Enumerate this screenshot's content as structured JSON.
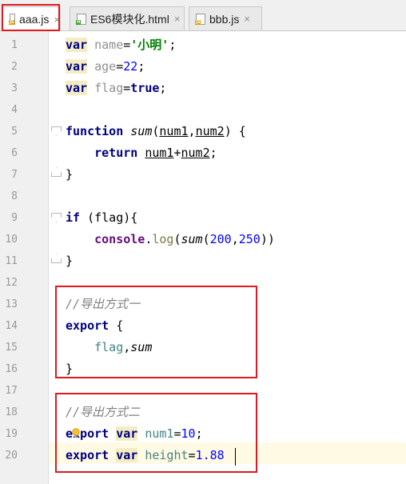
{
  "tabs": [
    {
      "label": "aaa.js",
      "type": "JS",
      "badge_color": "#d9a300",
      "active": true
    },
    {
      "label": "ES6模块化.html",
      "type": "H",
      "badge_color": "#3d9e2c",
      "active": false
    },
    {
      "label": "bbb.js",
      "type": "JS",
      "badge_color": "#d9a300",
      "active": false
    }
  ],
  "close_glyph": "×",
  "line_numbers": [
    "1",
    "2",
    "3",
    "4",
    "5",
    "6",
    "7",
    "8",
    "9",
    "10",
    "11",
    "12",
    "13",
    "14",
    "15",
    "16",
    "17",
    "18",
    "19",
    "20"
  ],
  "code": {
    "l1": {
      "kw": "var",
      "name": "name",
      "eq": "=",
      "str": "'小明'",
      "end": ";"
    },
    "l2": {
      "kw": "var",
      "name": "age",
      "eq": "=",
      "num": "22",
      "end": ";"
    },
    "l3": {
      "kw": "var",
      "name": "flag",
      "eq": "=",
      "val": "true",
      "end": ";"
    },
    "l5": {
      "kw": "function",
      "fn": "sum",
      "open": "(",
      "p1": "num1",
      "comma": ",",
      "p2": "num2",
      "close": ")",
      "brace": " {"
    },
    "l6": {
      "kw": "return",
      "p1": "num1",
      "plus": "+",
      "p2": "num2",
      "end": ";"
    },
    "l7": {
      "brace": "}"
    },
    "l9": {
      "kw": "if",
      "cond": " (flag)",
      "brace": "{"
    },
    "l10": {
      "obj": "console",
      "dot": ".",
      "mem": "log",
      "open": "(",
      "fn": "sum",
      "args_open": "(",
      "a1": "200",
      "comma": ",",
      "a2": "250",
      "close": "))"
    },
    "l11": {
      "brace": "}"
    },
    "l13": {
      "comment": "//导出方式一"
    },
    "l14": {
      "kw": "export",
      "brace": " {"
    },
    "l15": {
      "v1": "flag",
      "comma": ",",
      "fn": "sum"
    },
    "l16": {
      "brace": "}"
    },
    "l18": {
      "comment": "//导出方式二"
    },
    "l19": {
      "kw": "export",
      "kw2": "var",
      "name": "num1",
      "eq": "=",
      "num": "10",
      "end": ";"
    },
    "l20": {
      "kw": "export",
      "kw2": "var",
      "name": "height",
      "eq": "=",
      "num": "1.88"
    }
  }
}
